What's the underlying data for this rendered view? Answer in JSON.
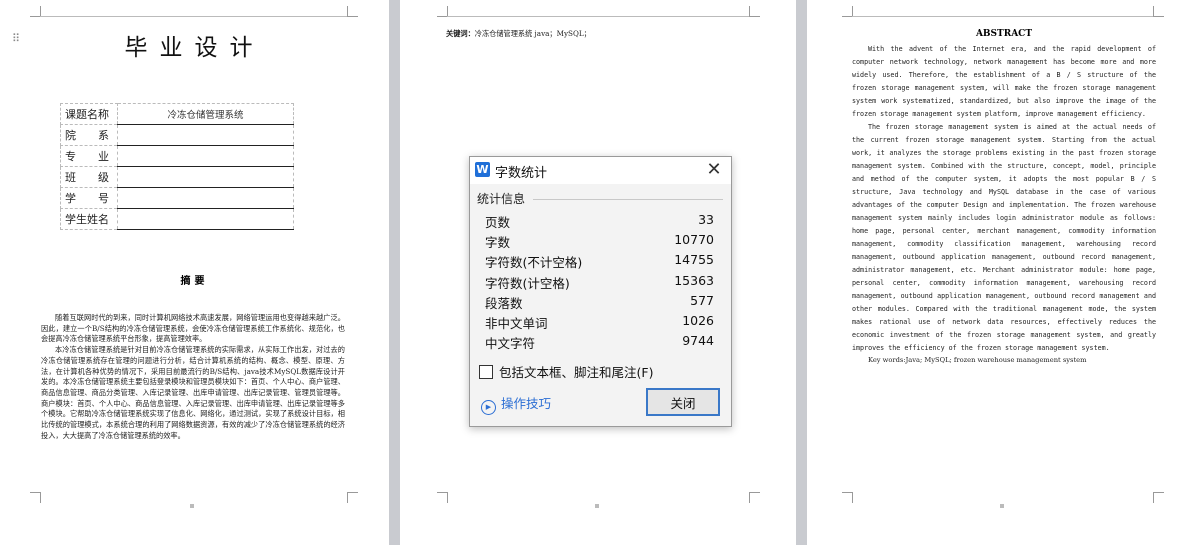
{
  "page1": {
    "title": "毕业设计",
    "info": [
      {
        "label": "课题名称",
        "value": "冷冻仓储管理系统"
      },
      {
        "label": "院　　系",
        "value": ""
      },
      {
        "label": "专　　业",
        "value": ""
      },
      {
        "label": "班　　级",
        "value": ""
      },
      {
        "label": "学　　号",
        "value": ""
      },
      {
        "label": "学生姓名",
        "value": ""
      }
    ],
    "abstract_heading": "摘要",
    "abstract_paragraphs": [
      "随着互联网时代的到来，同时计算机网络技术高速发展，网络管理运用也变得越来越广泛。因此，建立一个B/S结构的冷冻仓储管理系统，会使冷冻仓储管理系统工作系统化、规范化，也会提高冷冻仓储管理系统平台形象，提高管理效率。",
      "本冷冻仓储管理系统是针对目前冷冻仓储管理系统的实际需求，从实际工作出发，对过去的冷冻仓储管理系统存在管理的问题进行分析，结合计算机系统的结构、概念、模型、原理、方法，在计算机各种优势的情况下，采用目前最流行的B/S结构、java技术MySQL数据库设计开发的。本冷冻仓储管理系统主要包括登录模块和管理员模块如下：首页、个人中心、商户管理、商品信息管理、商品分类管理、入库记录管理、出库申请管理、出库记录管理、管理员管理等。商户模块：首页、个人中心、商品信息管理、入库记录管理、出库申请管理、出库记录管理等多个模块。它帮助冷冻仓储管理系统实现了信息化、网络化，通过测试，实现了系统设计目标，相比传统的管理模式，本系统合理的利用了网络数据资源，有效的减少了冷冻仓储管理系统的经济投入，大大提高了冷冻仓储管理系统的效率。"
    ]
  },
  "page2": {
    "keywords_label": "关键词：",
    "keywords": "冷冻仓储管理系统 java；MySQL；"
  },
  "page3": {
    "title": "ABSTRACT",
    "paragraphs": [
      "With the advent of the Internet era, and the rapid development of computer network technology, network management has become more and more widely used. Therefore, the establishment of a B / S structure of the frozen storage management system, will make the frozen storage management system work systematized, standardized, but also improve the image of the frozen storage management system platform, improve management efficiency.",
      "The frozen storage management system is aimed at the actual needs of the current frozen storage management system. Starting from the actual work, it analyzes the storage problems existing in the past frozen storage management system. Combined with the structure, concept, model, principle and method of the computer system, it adopts the most popular B / S structure, Java technology and MySQL database in the case of various advantages of the computer Design and implementation. The frozen warehouse management system mainly includes login administrator module as follows: home page, personal center, merchant management, commodity information management, commodity classification management, warehousing record management, outbound application management, outbound record management, administrator management, etc. Merchant administrator module: home page, personal center, commodity information management, warehousing record management, outbound application management, outbound record management and other modules. Compared with the traditional management mode, the system makes rational use of network data resources, effectively reduces the economic investment of the frozen storage management system, and greatly improves the efficiency of the frozen storage management system."
    ],
    "keywords": "Key words:Java; MySQL; frozen warehouse management system"
  },
  "dialog": {
    "title": "字数统计",
    "app_icon": "W",
    "close_icon": "✕",
    "group_label": "统计信息",
    "stats": [
      {
        "label": "页数",
        "value": "33"
      },
      {
        "label": "字数",
        "value": "10770"
      },
      {
        "label": "字符数(不计空格)",
        "value": "14755"
      },
      {
        "label": "字符数(计空格)",
        "value": "15363"
      },
      {
        "label": "段落数",
        "value": "577"
      },
      {
        "label": "非中文单词",
        "value": "1026"
      },
      {
        "label": "中文字符",
        "value": "9744"
      }
    ],
    "checkbox_label": "包括文本框、脚注和尾注(F)",
    "checkbox_checked": false,
    "tips_label": "操作技巧",
    "close_button": "关闭"
  },
  "colors": {
    "accent": "#2b6ed4",
    "app_icon": "#1f6fd8",
    "workspace": "#c9cbd0"
  }
}
